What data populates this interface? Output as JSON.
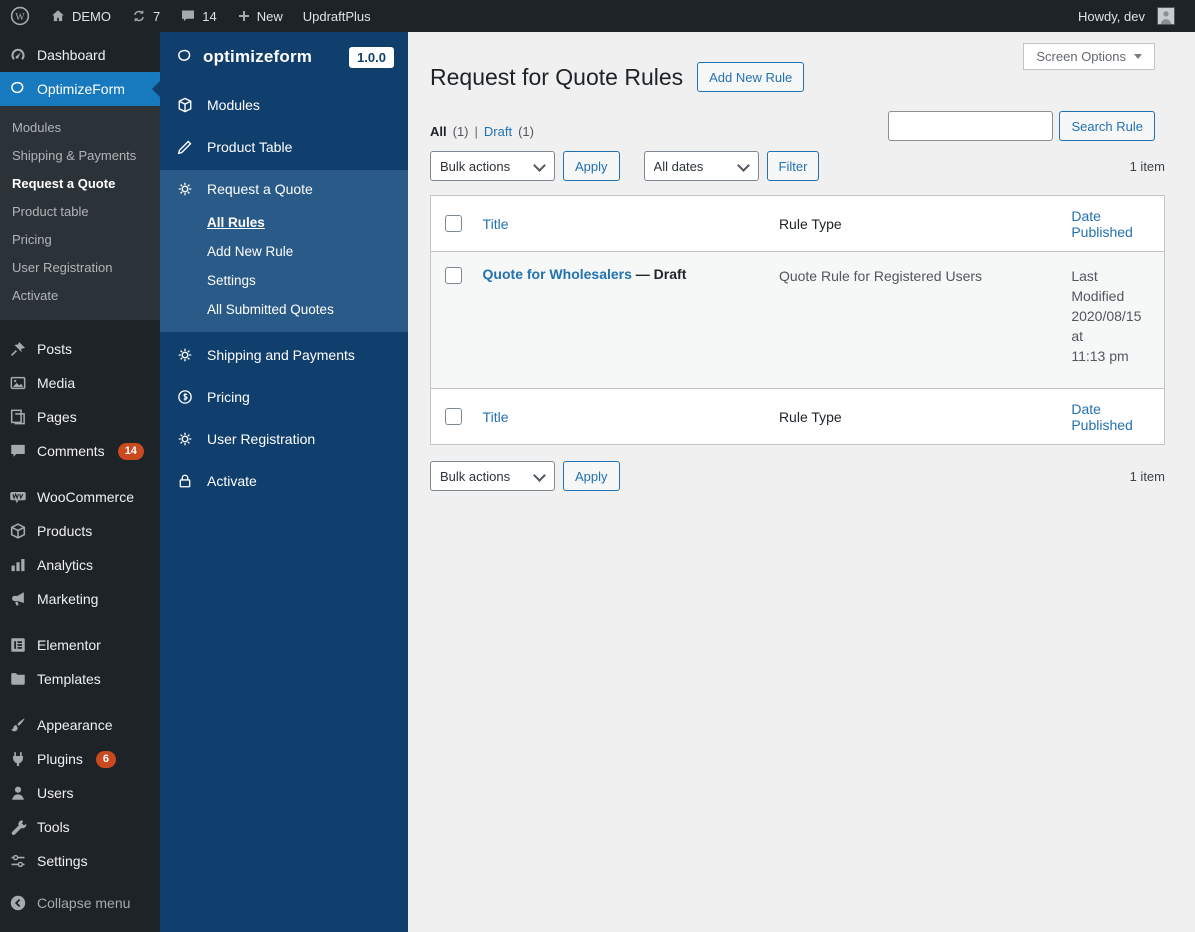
{
  "admin_bar": {
    "site": "DEMO",
    "updates": "7",
    "comments": "14",
    "new_label": "New",
    "updraft": "UpdraftPlus",
    "howdy": "Howdy, dev"
  },
  "wp_menu": {
    "dashboard": "Dashboard",
    "optimizeform": "OptimizeForm",
    "of_sub": [
      "Modules",
      "Shipping & Payments",
      "Request a Quote",
      "Product table",
      "Pricing",
      "User Registration",
      "Activate"
    ],
    "posts": "Posts",
    "media": "Media",
    "pages": "Pages",
    "comments": "Comments",
    "comments_badge": "14",
    "woocommerce": "WooCommerce",
    "products": "Products",
    "analytics": "Analytics",
    "marketing": "Marketing",
    "elementor": "Elementor",
    "templates": "Templates",
    "appearance": "Appearance",
    "plugins": "Plugins",
    "plugins_badge": "6",
    "users": "Users",
    "tools": "Tools",
    "settings": "Settings",
    "collapse": "Collapse menu"
  },
  "plugin_panel": {
    "brand": "optimizeform",
    "version": "1.0.0",
    "modules": "Modules",
    "product_table": "Product Table",
    "request_quote": "Request a Quote",
    "sub": [
      "All Rules",
      "Add New Rule",
      "Settings",
      "All Submitted Quotes"
    ],
    "shipping": "Shipping and Payments",
    "pricing": "Pricing",
    "user_registration": "User Registration",
    "activate": "Activate"
  },
  "page": {
    "title": "Request for Quote Rules",
    "add_new": "Add New Rule",
    "screen_options": "Screen Options",
    "search_button": "Search Rule",
    "views": {
      "all": "All",
      "all_count": "(1)",
      "sep": "|",
      "draft": "Draft",
      "draft_count": "(1)"
    },
    "bulk_actions": "Bulk actions",
    "apply": "Apply",
    "all_dates": "All dates",
    "filter": "Filter",
    "item_count": "1 item",
    "table": {
      "col_title": "Title",
      "col_rule_type": "Rule Type",
      "col_date": "Date Published",
      "row": {
        "title": "Quote for Wholesalers",
        "state": "— Draft",
        "rule_type": "Quote Rule for Registered Users",
        "date_line1": "Last Modified",
        "date_line2": "2020/08/15 at",
        "date_line3": "11:13 pm"
      }
    },
    "colors": {
      "accent": "#2271b1",
      "panel_navy": "#113f6d",
      "panel_active": "#2a5a87",
      "menu_highlight": "#1779be",
      "badge": "#ca4a1f"
    }
  }
}
